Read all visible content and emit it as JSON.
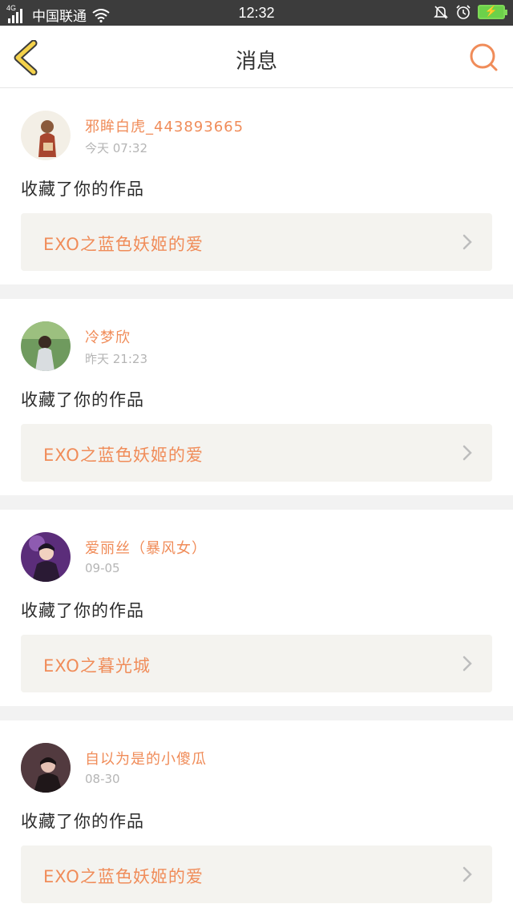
{
  "status_bar": {
    "network": "4G",
    "carrier": "中国联通",
    "time": "12:32",
    "icons": [
      "signal-icon",
      "wifi-icon",
      "bell-muted-icon",
      "alarm-icon",
      "battery-charging-icon"
    ]
  },
  "nav": {
    "title": "消息",
    "back_icon": "back-chevron-icon",
    "search_icon": "search-icon"
  },
  "colors": {
    "accent": "#f08c59",
    "back_icon": "#f4d24b",
    "status_bar_bg": "#3c3c3c"
  },
  "messages": [
    {
      "username": "邪眸白虎_443893665",
      "time": "今天 07:32",
      "action": "收藏了你的作品",
      "work_title": "EXO之蓝色妖姬的爱",
      "avatar": "user-avatar"
    },
    {
      "username": "冷梦欣",
      "time": "昨天 21:23",
      "action": "收藏了你的作品",
      "work_title": "EXO之蓝色妖姬的爱",
      "avatar": "user-avatar"
    },
    {
      "username": "爱丽丝（暴风女）",
      "time": "09-05",
      "action": "收藏了你的作品",
      "work_title": "EXO之暮光城",
      "avatar": "user-avatar"
    },
    {
      "username": "自以为是的小傻瓜",
      "time": "08-30",
      "action": "收藏了你的作品",
      "work_title": "EXO之蓝色妖姬的爱",
      "avatar": "user-avatar"
    }
  ]
}
